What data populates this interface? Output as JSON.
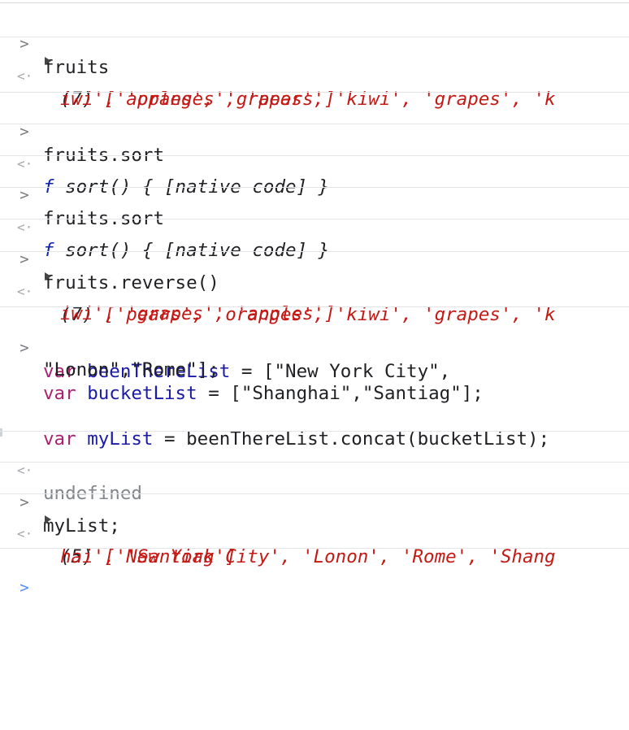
{
  "prompt_symbol": ">",
  "result_symbol": "<·",
  "entries": [
    {
      "input": "fruits",
      "output_count": "(7)",
      "output_line1": "['apples', 'grapes', 'kiwi', 'grapes', 'k",
      "output_line2": "iwi', 'oranges', 'pears']"
    },
    {
      "input": "fruits.sort",
      "output_f": "f",
      "output_text": "sort() { [native code] }"
    },
    {
      "input": "fruits.sort",
      "output_f": "f",
      "output_text": "sort() { [native code] }"
    },
    {
      "input": "fruits.reverse()",
      "output_count": "(7)",
      "output_line1": "['pears', 'oranges', 'kiwi', 'grapes', 'k",
      "output_line2": "iwi', 'grapes', 'apples']"
    },
    {
      "code_lines": [
        [
          "var",
          "beenThereList",
          " = [\"New York City\","
        ],
        [
          "\"Lonon\",\"Rome\"];"
        ],
        [
          "var",
          "bucketList",
          " = [\"Shanghai\",\"Santiag\"];"
        ],
        [
          ""
        ],
        [
          "var",
          "myList",
          " = beenThereList.concat(bucketList);"
        ]
      ],
      "output": "undefined"
    },
    {
      "input": "myList;",
      "output_count": "(5)",
      "output_line1": "['New York City', 'Lonon', 'Rome', 'Shang",
      "output_line2": "hai', 'Santiag']"
    }
  ],
  "theme": {
    "keyword": "#a6226f",
    "variable": "#1a1aa6",
    "string": "#c41a16",
    "undefined": "#80868b",
    "prompt_active": "#4f8ef7"
  }
}
